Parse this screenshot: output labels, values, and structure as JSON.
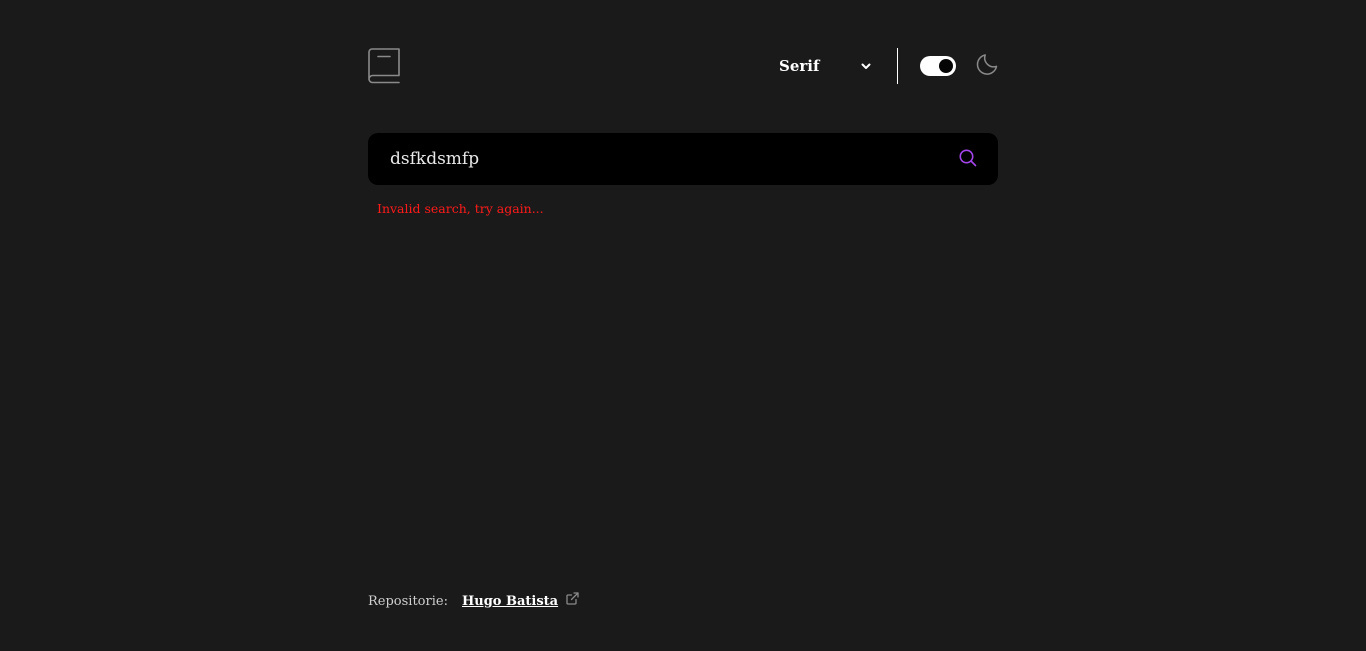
{
  "header": {
    "logo_icon": "book-icon",
    "font_select": {
      "selected": "Serif",
      "icon": "chevron-down-icon"
    },
    "theme_toggle": {
      "state": "on",
      "icon": "moon-icon"
    }
  },
  "search": {
    "value": "dsfkdsmfp",
    "icon": "search-icon",
    "icon_color": "#a445ed"
  },
  "error": {
    "message": "Invalid search, try again...",
    "color": "#ff1a1a"
  },
  "footer": {
    "label": "Repositorie:",
    "link_text": "Hugo Batista",
    "link_icon": "external-link-icon"
  },
  "colors": {
    "background": "#1a1a1a",
    "search_bg": "#000000",
    "text": "#ffffff"
  }
}
